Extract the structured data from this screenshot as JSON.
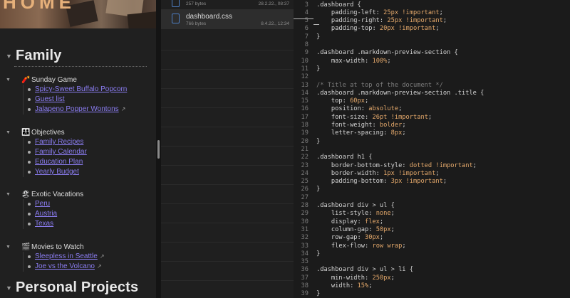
{
  "preview": {
    "banner_title": "HOME",
    "sections": [
      {
        "title": "Family"
      },
      {
        "title": "Personal Projects"
      }
    ],
    "groups": [
      {
        "emoji": "🧨",
        "title": "Sunday Game",
        "items": [
          {
            "label": "Spicy-Sweet Buffalo Popcorn",
            "external": false
          },
          {
            "label": "Guest list",
            "external": false
          },
          {
            "label": "Jalapeno Popper Wontons",
            "external": true
          }
        ]
      },
      {
        "emoji": "👪",
        "title": "Objectives",
        "items": [
          {
            "label": "Family Recipes",
            "external": false
          },
          {
            "label": "Family Calendar",
            "external": false
          },
          {
            "label": "Education Plan",
            "external": false
          },
          {
            "label": "Yearly Budget",
            "external": false
          }
        ]
      },
      {
        "emoji": "🏖",
        "title": "Exotic Vacations",
        "items": [
          {
            "label": "Peru",
            "external": false
          },
          {
            "label": "Austria",
            "external": false
          },
          {
            "label": "Texas",
            "external": false
          }
        ]
      },
      {
        "emoji": "🎬",
        "title": "Movies to Watch",
        "items": [
          {
            "label": "Sleepless in Seattle",
            "external": true
          },
          {
            "label": "Joe vs the Volcano",
            "external": true
          }
        ]
      }
    ]
  },
  "files": [
    {
      "name": "",
      "size": "257 bytes",
      "date": "28.2.22., 08:37",
      "selected": false
    },
    {
      "name": "dashboard.css",
      "size": "766 bytes",
      "date": "8.4.22., 12:34",
      "selected": true
    }
  ],
  "code": {
    "lines": [
      {
        "n": "3",
        "text": ".dashboard {"
      },
      {
        "n": "4",
        "text": "    padding-left: 25px !important;"
      },
      {
        "n": "5",
        "text": "    padding-right: 25px !important;"
      },
      {
        "n": "6",
        "text": "    padding-top: 20px !important;"
      },
      {
        "n": "7",
        "text": "}"
      },
      {
        "n": "8",
        "text": ""
      },
      {
        "n": "9",
        "text": ".dashboard .markdown-preview-section {"
      },
      {
        "n": "10",
        "text": "    max-width: 100%;"
      },
      {
        "n": "11",
        "text": "}"
      },
      {
        "n": "12",
        "text": ""
      },
      {
        "n": "13",
        "text": "/* Title at top of the document */"
      },
      {
        "n": "14",
        "text": ".dashboard .markdown-preview-section .title {"
      },
      {
        "n": "15",
        "text": "    top: 60px;"
      },
      {
        "n": "16",
        "text": "    position: absolute;"
      },
      {
        "n": "17",
        "text": "    font-size: 26pt !important;"
      },
      {
        "n": "18",
        "text": "    font-weight: bolder;"
      },
      {
        "n": "19",
        "text": "    letter-spacing: 8px;"
      },
      {
        "n": "20",
        "text": "}"
      },
      {
        "n": "21",
        "text": ""
      },
      {
        "n": "22",
        "text": ".dashboard h1 {"
      },
      {
        "n": "23",
        "text": "    border-bottom-style: dotted !important;"
      },
      {
        "n": "24",
        "text": "    border-width: 1px !important;"
      },
      {
        "n": "25",
        "text": "    padding-bottom: 3px !important;"
      },
      {
        "n": "26",
        "text": "}"
      },
      {
        "n": "27",
        "text": ""
      },
      {
        "n": "28",
        "text": ".dashboard div > ul {"
      },
      {
        "n": "29",
        "text": "    list-style: none;"
      },
      {
        "n": "30",
        "text": "    display: flex;"
      },
      {
        "n": "31",
        "text": "    column-gap: 50px;"
      },
      {
        "n": "32",
        "text": "    row-gap: 30px;"
      },
      {
        "n": "33",
        "text": "    flex-flow: row wrap;"
      },
      {
        "n": "34",
        "text": "}"
      },
      {
        "n": "35",
        "text": ""
      },
      {
        "n": "36",
        "text": ".dashboard div > ul > li {"
      },
      {
        "n": "37",
        "text": "    min-width: 250px;"
      },
      {
        "n": "38",
        "text": "    width: 15%;"
      },
      {
        "n": "39",
        "text": "}"
      }
    ]
  }
}
